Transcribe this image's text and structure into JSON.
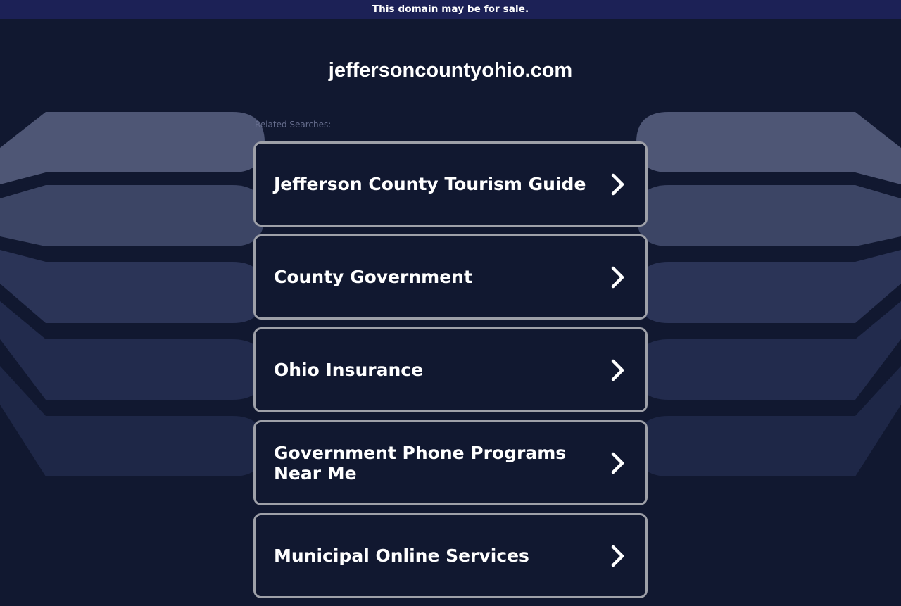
{
  "banner": {
    "text": "This domain may be for sale."
  },
  "site": {
    "domain": "jeffersoncountyohio.com"
  },
  "related": {
    "label": "Related Searches:",
    "items": [
      {
        "label": "Jefferson County Tourism Guide",
        "icon": "chevron-right-icon"
      },
      {
        "label": "County Government",
        "icon": "chevron-right-icon"
      },
      {
        "label": "Ohio Insurance",
        "icon": "chevron-right-icon"
      },
      {
        "label": "Government Phone Programs Near Me",
        "icon": "chevron-right-icon"
      },
      {
        "label": "Municipal Online Services",
        "icon": "chevron-right-icon"
      }
    ]
  },
  "colors": {
    "background": "#111830",
    "banner": "#1c2156",
    "card_border": "#9ea0a8",
    "text": "#ffffff",
    "muted_text": "#656c8c"
  }
}
